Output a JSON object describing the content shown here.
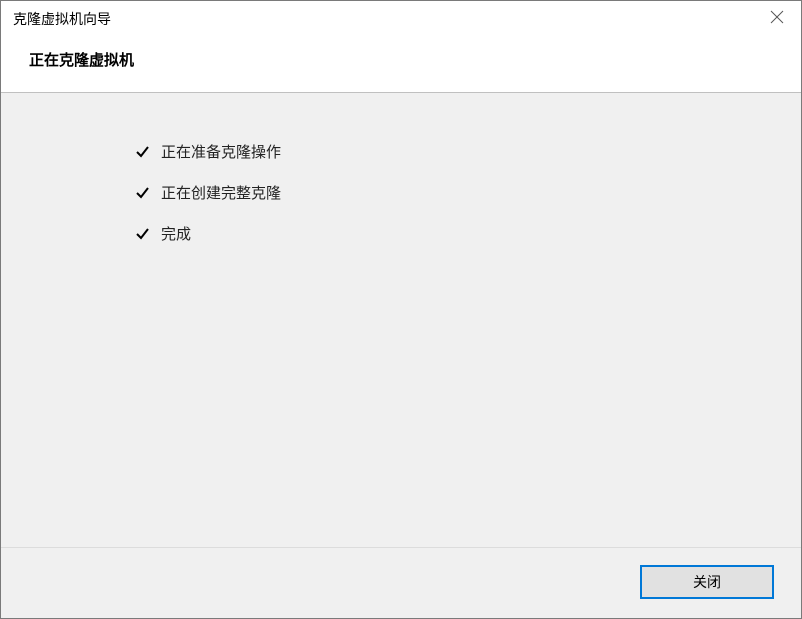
{
  "titlebar": {
    "title": "克隆虚拟机向导"
  },
  "header": {
    "title": "正在克隆虚拟机"
  },
  "steps": {
    "items": [
      {
        "label": "正在准备克隆操作"
      },
      {
        "label": "正在创建完整克隆"
      },
      {
        "label": "完成"
      }
    ]
  },
  "footer": {
    "close_label": "关闭"
  }
}
